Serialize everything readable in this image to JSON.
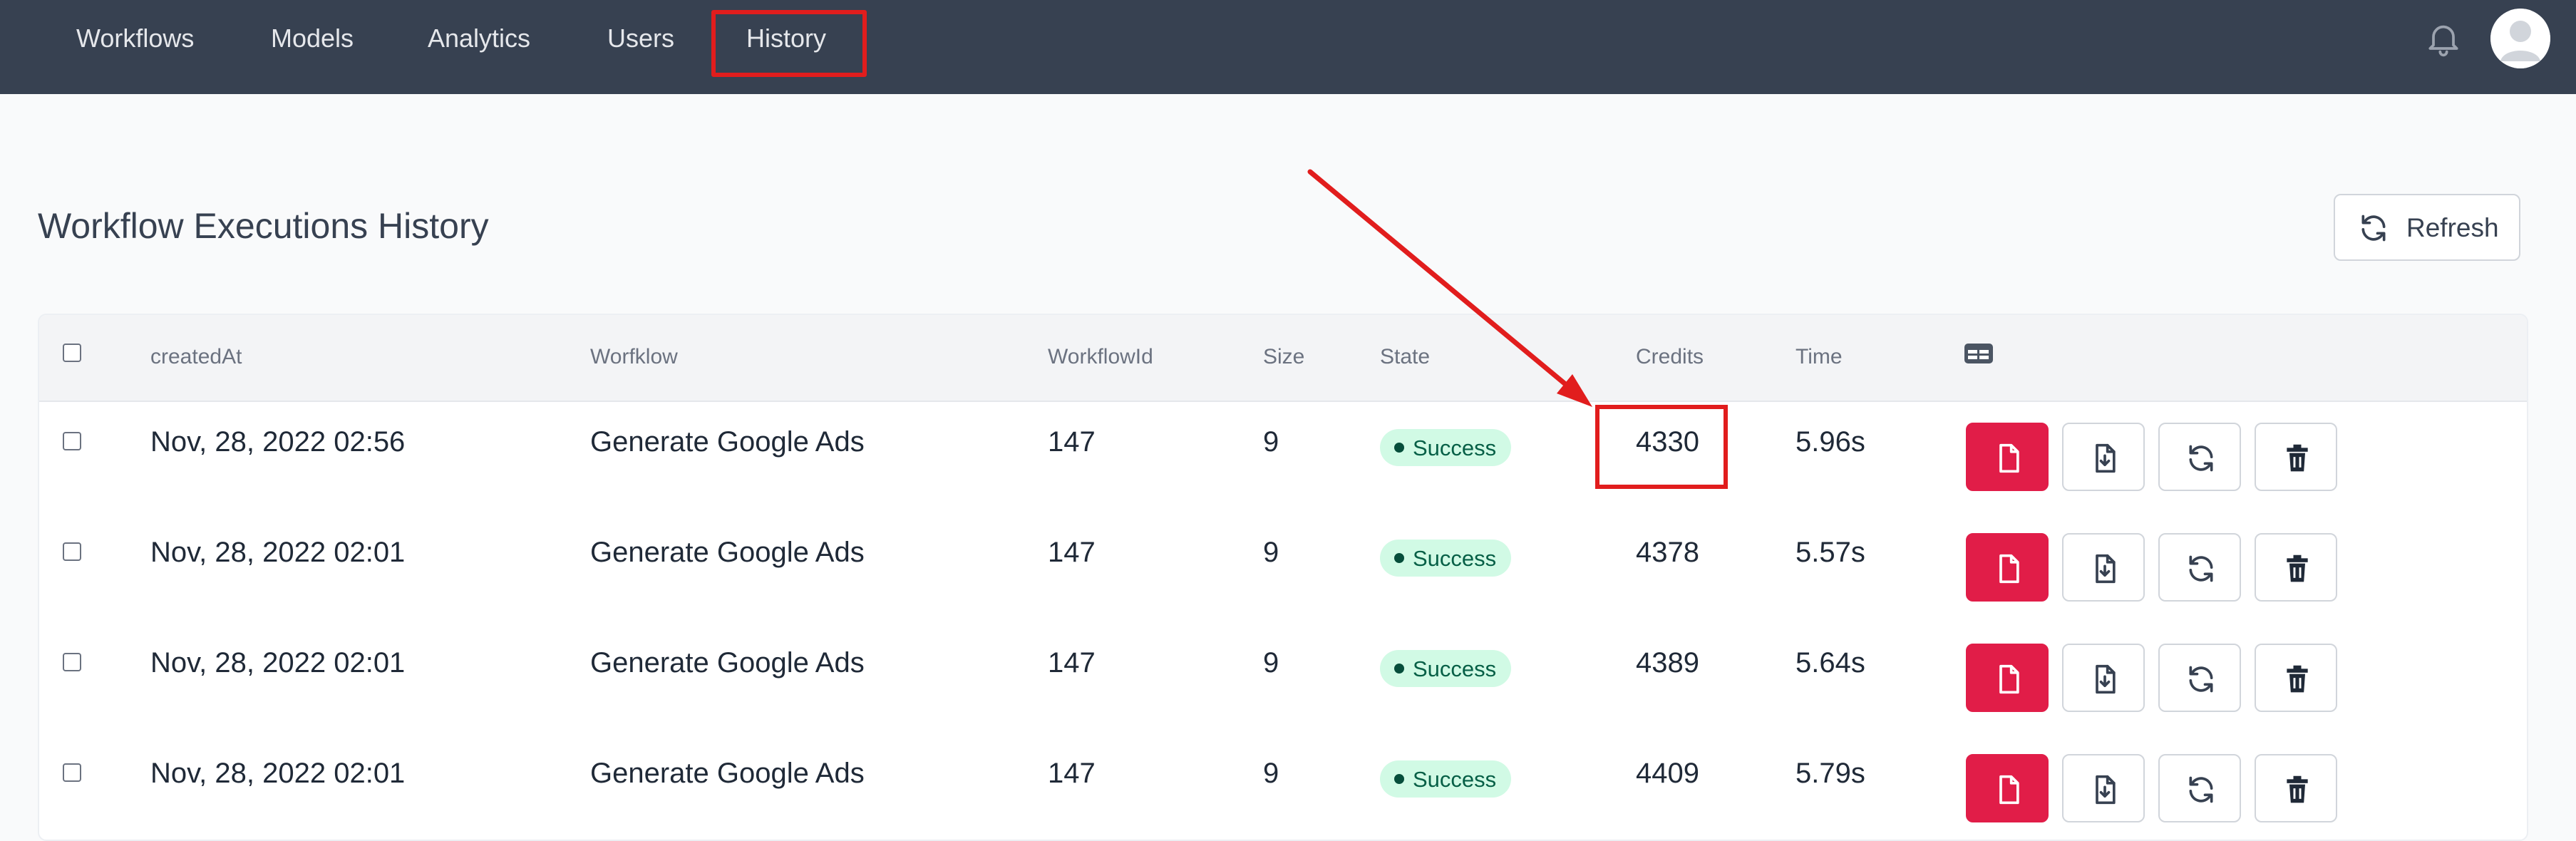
{
  "nav": {
    "items": [
      "Workflows",
      "Models",
      "Analytics",
      "Users",
      "History"
    ]
  },
  "page": {
    "title": "Workflow Executions History",
    "refresh_label": "Refresh"
  },
  "table": {
    "columns": {
      "created_at": "createdAt",
      "workflow": "Worfklow",
      "workflow_id": "WorkflowId",
      "size": "Size",
      "state": "State",
      "credits": "Credits",
      "time": "Time"
    },
    "rows": [
      {
        "created_at": "Nov, 28, 2022 02:56",
        "workflow": "Generate Google Ads",
        "workflow_id": "147",
        "size": "9",
        "state": "Success",
        "credits": "4330",
        "time": "5.96s"
      },
      {
        "created_at": "Nov, 28, 2022 02:01",
        "workflow": "Generate Google Ads",
        "workflow_id": "147",
        "size": "9",
        "state": "Success",
        "credits": "4378",
        "time": "5.57s"
      },
      {
        "created_at": "Nov, 28, 2022 02:01",
        "workflow": "Generate Google Ads",
        "workflow_id": "147",
        "size": "9",
        "state": "Success",
        "credits": "4389",
        "time": "5.64s"
      },
      {
        "created_at": "Nov, 28, 2022 02:01",
        "workflow": "Generate Google Ads",
        "workflow_id": "147",
        "size": "9",
        "state": "Success",
        "credits": "4409",
        "time": "5.79s"
      }
    ],
    "row_actions": [
      "file-icon",
      "download-file-icon",
      "rerun-icon",
      "trash-icon"
    ]
  },
  "icons": {
    "notifications": "bell-icon",
    "user": "avatar",
    "refresh": "refresh-icon",
    "column_settings": "columns-icon"
  },
  "colors": {
    "navbar": "#374151",
    "primary_action": "#e11d48",
    "success_badge_bg": "#d1fae5",
    "success_badge_text": "#065f46",
    "annotation": "#e11d1d"
  }
}
